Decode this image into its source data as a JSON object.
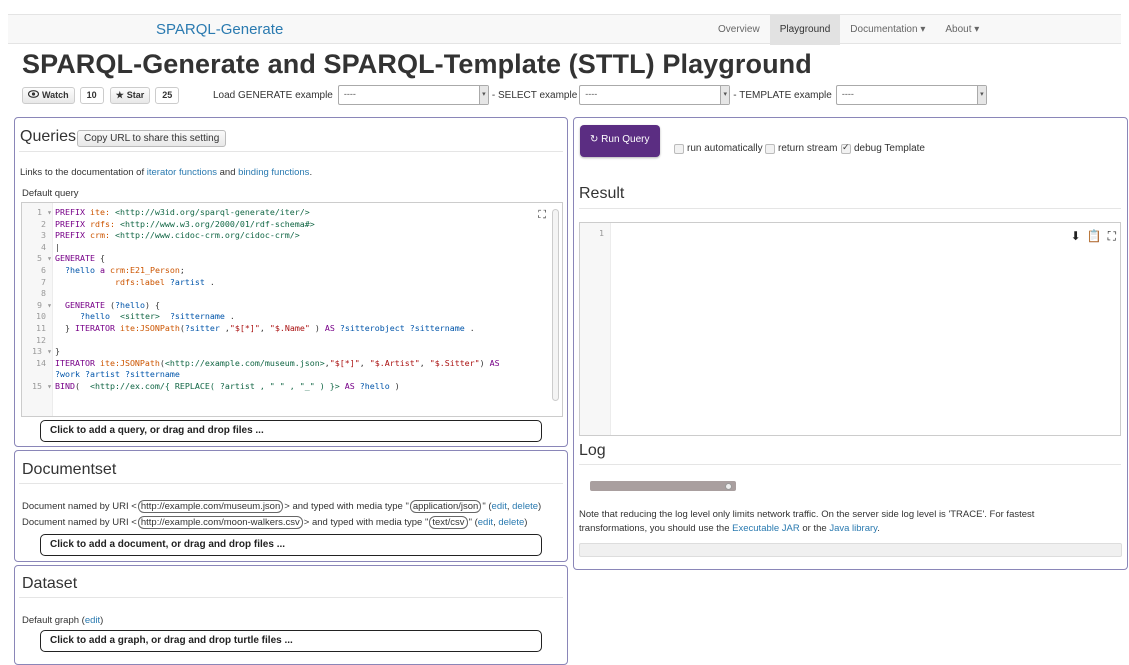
{
  "navbar": {
    "brand": "SPARQL-Generate",
    "items": [
      "Overview",
      "Playground",
      "Documentation ▾",
      "About ▾"
    ]
  },
  "page": {
    "title": "SPARQL-Generate and SPARQL-Template (STTL) Playground"
  },
  "github": {
    "watch_label": "Watch",
    "watch_count": "10",
    "star_label": "Star",
    "star_count": "25"
  },
  "examples": {
    "generate_label": "Load GENERATE example",
    "select_label": "- SELECT example",
    "template_label": "- TEMPLATE example",
    "placeholder": "----"
  },
  "queries": {
    "title": "Queries",
    "copy_button": "Copy URL to share this setting",
    "links_prefix": "Links to the documentation of ",
    "link_iterator": "iterator functions",
    "links_and": " and ",
    "link_binding": "binding functions",
    "links_suffix": ".",
    "default_label": "Default query",
    "add_label": "Click to add a query, or drag and drop files ...",
    "code_lines": [
      {
        "n": "1",
        "fold": true,
        "html": "<span class='kw'>PREFIX</span> <span class='pfx'>ite:</span> <span class='iri'>&lt;http://w3id.org/sparql-generate/iter/&gt;</span>"
      },
      {
        "n": "2",
        "fold": false,
        "html": "<span class='kw'>PREFIX</span> <span class='pfx'>rdfs:</span> <span class='iri'>&lt;http://www.w3.org/2000/01/rdf-schema#&gt;</span>"
      },
      {
        "n": "3",
        "fold": false,
        "html": "<span class='kw'>PREFIX</span> <span class='pfx'>crm:</span> <span class='iri'>&lt;http://www.cidoc-crm.org/cidoc-crm/&gt;</span>"
      },
      {
        "n": "4",
        "fold": false,
        "html": "|"
      },
      {
        "n": "5",
        "fold": true,
        "html": "<span class='kw'>GENERATE</span> {"
      },
      {
        "n": "6",
        "fold": false,
        "html": "  <span class='var'>?hello</span> <span class='kw'>a</span> <span class='pfx'>crm:E21_Person</span>;"
      },
      {
        "n": "7",
        "fold": false,
        "html": "            <span class='pfx'>rdfs:label</span> <span class='var'>?artist</span> ."
      },
      {
        "n": "8",
        "fold": false,
        "html": ""
      },
      {
        "n": "9",
        "fold": true,
        "html": "  <span class='kw'>GENERATE</span> (<span class='var'>?hello</span>) {"
      },
      {
        "n": "10",
        "fold": false,
        "html": "     <span class='var'>?hello</span>  <span class='iri'>&lt;sitter&gt;</span>  <span class='var'>?sittername</span> ."
      },
      {
        "n": "11",
        "fold": false,
        "html": "  } <span class='kw'>ITERATOR</span> <span class='pfx'>ite:JSONPath</span>(<span class='var'>?sitter</span> ,<span class='str'>\"$[*]\"</span>, <span class='str'>\"$.Name\"</span> ) <span class='kw'>AS</span> <span class='var'>?sitterobject</span> <span class='var'>?sittername</span> ."
      },
      {
        "n": "12",
        "fold": false,
        "html": ""
      },
      {
        "n": "13",
        "fold": true,
        "html": "}"
      },
      {
        "n": "14",
        "fold": false,
        "html": "<span class='kw'>ITERATOR</span> <span class='pfx'>ite:JSONPath</span>(<span class='iri'>&lt;http://example.com/museum.json&gt;</span>,<span class='str'>\"$[*]\"</span>, <span class='str'>\"$.Artist\"</span>, <span class='str'>\"$.Sitter\"</span>) <span class='kw'>AS</span>"
      },
      {
        "n": "",
        "fold": false,
        "html": "<span class='var'>?work</span> <span class='var'>?artist</span> <span class='var'>?sittername</span>"
      },
      {
        "n": "15",
        "fold": true,
        "html": "<span class='kw'>BIND</span>(  <span class='iri'>&lt;http://ex.com/{ REPLACE( ?artist , \" \" , \"_\" ) }&gt;</span> <span class='kw'>AS</span> <span class='var'>?hello</span> )"
      }
    ]
  },
  "documentset": {
    "title": "Documentset",
    "doc_prefix": "Document named by URI <",
    "doc_mid": "> and typed with media type \"",
    "doc_end": "\" (",
    "edit": "edit",
    "comma": ", ",
    "delete": "delete",
    "close": ")",
    "doc1_uri": "http://example.com/museum.json",
    "doc1_type": "application/json",
    "doc2_uri": "http://example.com/moon-walkers.csv",
    "doc2_type": "text/csv",
    "add_label": "Click to add a document, or drag and drop files ..."
  },
  "dataset": {
    "title": "Dataset",
    "default_graph": "Default graph (",
    "edit": "edit",
    "close": ")",
    "add_label": "Click to add a graph, or drag and drop turtle files ..."
  },
  "run": {
    "button": "↻ Run Query",
    "opt_auto": "run automatically",
    "opt_stream": "return stream",
    "opt_debug": "debug Template"
  },
  "result": {
    "title": "Result",
    "line1": "1"
  },
  "log": {
    "title": "Log",
    "note_a": "Note that reducing the log level only limits network traffic. On the server side log level is 'TRACE'. For fastest",
    "note_b": "transformations, you should use the ",
    "link_jar": "Executable JAR",
    "note_or": " or the ",
    "link_lib": "Java library",
    "note_end": "."
  }
}
